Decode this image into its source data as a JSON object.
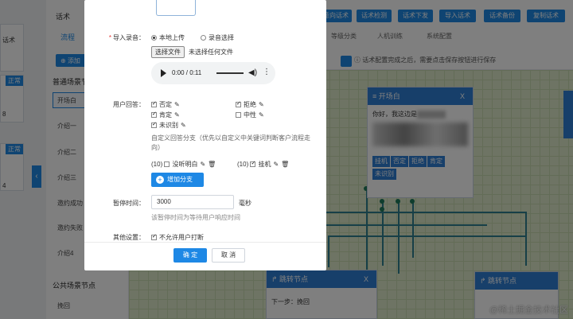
{
  "background": {
    "left_cards": [
      {
        "label": "话术",
        "badge": ""
      },
      {
        "label": "",
        "badge": "正常"
      },
      {
        "label": "",
        "badge": "正常"
      }
    ],
    "left_card_digits": [
      "8",
      "4"
    ],
    "collapse_arrow": "‹",
    "side": {
      "add_button": "添加",
      "main_section": "普通场景节点",
      "items": [
        "开场白",
        "介绍一",
        "介绍二",
        "介绍三",
        "邀约成功",
        "邀约失败",
        "介绍4"
      ],
      "public_section": "公共场景节点",
      "public_items": [
        "挽回"
      ]
    },
    "header": {
      "title": "话术",
      "tab_flow": "流程",
      "buttons": [
        "意向话术",
        "话术检测",
        "话术下发",
        "导入话术",
        "话术备份",
        "复制话术"
      ],
      "tabs": [
        "等级分类",
        "人机训练",
        "系统配置"
      ],
      "notice": "ⓘ 话术配置完成之后，需要点击保存按钮进行保存"
    },
    "nodes": {
      "start": {
        "title": "开场白",
        "close": "X",
        "greeting": "你好，我这边是",
        "tags": [
          "挂机",
          "否定",
          "拒绝",
          "肯定",
          "未识别"
        ]
      },
      "jump1": {
        "title": "跳转节点",
        "close": "X",
        "next": "下一步：挽回"
      },
      "jump2": {
        "title": "跳转节点"
      }
    },
    "watermark": "@稀土掘金技术社区"
  },
  "modal": {
    "import_label": "导入录音：",
    "upload_option": "本地上传",
    "record_option": "录音选择",
    "file_button": "选择文件",
    "file_status": "未选择任何文件",
    "audio_time": "0:00 / 0:11",
    "answer_label": "用户回答：",
    "answers_left": [
      {
        "label": "否定",
        "checked": true
      },
      {
        "label": "肯定",
        "checked": true
      },
      {
        "label": "未识别",
        "checked": true
      }
    ],
    "answers_right": [
      {
        "label": "拒绝",
        "checked": true
      },
      {
        "label": "中性",
        "checked": false
      }
    ],
    "custom_branch_hint": "自定义回答分支（优先以自定义中关键词判断客户流程走向）",
    "branch1_num": "(10)",
    "branch1_label": "没听明白",
    "branch2_num": "(10)",
    "branch2_label": "挂机",
    "add_branch": "增加分支",
    "pause_label": "暂停时间：",
    "pause_value": "3000",
    "pause_unit": "毫秒",
    "pause_hint": "该暂停时间为等待用户响应时间",
    "other_label": "其他设置：",
    "no_interrupt": "不允许用户打断",
    "ok": "确 定",
    "cancel": "取 消"
  }
}
